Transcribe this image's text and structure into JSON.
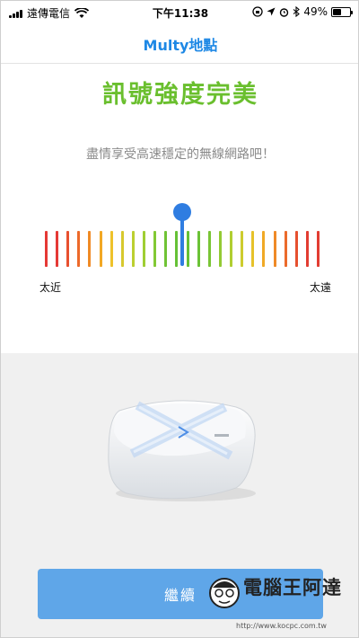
{
  "status_bar": {
    "carrier": "遠傳電信",
    "time": "下午11:38",
    "battery": "49%",
    "battery_level": 0.49
  },
  "nav": {
    "title": "Multy地點"
  },
  "headline": "訊號強度完美",
  "subtitle": "盡情享受高速穩定的無線網路吧！",
  "meter": {
    "left_label": "太近",
    "right_label": "太遠",
    "tick_colors": [
      "#e53935",
      "#e53935",
      "#e8502f",
      "#ed6a2a",
      "#f08a25",
      "#f2a824",
      "#eec22a",
      "#d7c92e",
      "#bccf30",
      "#9fce33",
      "#82c934",
      "#70c335",
      "#66c136",
      "#66c136",
      "#6ac236",
      "#79c535",
      "#93ca34",
      "#b0ce31",
      "#cdcc2d",
      "#e6c22a",
      "#f0a926",
      "#ef8a27",
      "#eb6a2b",
      "#e6502f",
      "#e23d32",
      "#e23d32"
    ],
    "signal_position": 0.5
  },
  "device_colors": {
    "accent": "#4f8fe6"
  },
  "button": {
    "continue_label": "繼續"
  },
  "watermark": {
    "text": "電腦王阿達",
    "url": "http://www.kocpc.com.tw"
  }
}
